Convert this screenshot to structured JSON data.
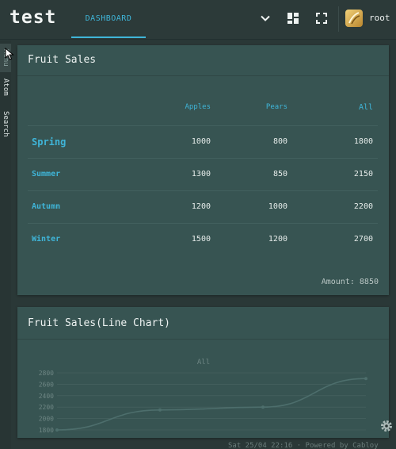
{
  "app": {
    "logo": "test",
    "tab": "DASHBOARD",
    "user": "root"
  },
  "rail": {
    "items": [
      "Menu",
      "Atom",
      "Search"
    ]
  },
  "sales_table": {
    "title": "Fruit Sales",
    "headers": [
      "",
      "Apples",
      "Pears",
      "All"
    ],
    "rows": [
      {
        "season": "Spring",
        "apples": "1000",
        "pears": "800",
        "all": "1800"
      },
      {
        "season": "Summer",
        "apples": "1300",
        "pears": "850",
        "all": "2150"
      },
      {
        "season": "Autumn",
        "apples": "1200",
        "pears": "1000",
        "all": "2200"
      },
      {
        "season": "Winter",
        "apples": "1500",
        "pears": "1200",
        "all": "2700"
      }
    ],
    "amount_label": "Amount:",
    "amount_value": "8850"
  },
  "line_card": {
    "title": "Fruit Sales(Line Chart)"
  },
  "chart_data": {
    "type": "line",
    "legend": [
      "All"
    ],
    "yticks": [
      "1800",
      "2000",
      "2200",
      "2400",
      "2600",
      "2800"
    ],
    "ylim": [
      1800,
      2800
    ],
    "series": [
      {
        "name": "All",
        "values": [
          1800,
          2150,
          2200,
          2700
        ]
      }
    ],
    "colors": {
      "line": "#4d6e6c",
      "grid": "#4a6462",
      "text": "#6e8684"
    }
  },
  "footer": {
    "text": "Sat 25/04 22:16 · Powered by Cabloy"
  }
}
